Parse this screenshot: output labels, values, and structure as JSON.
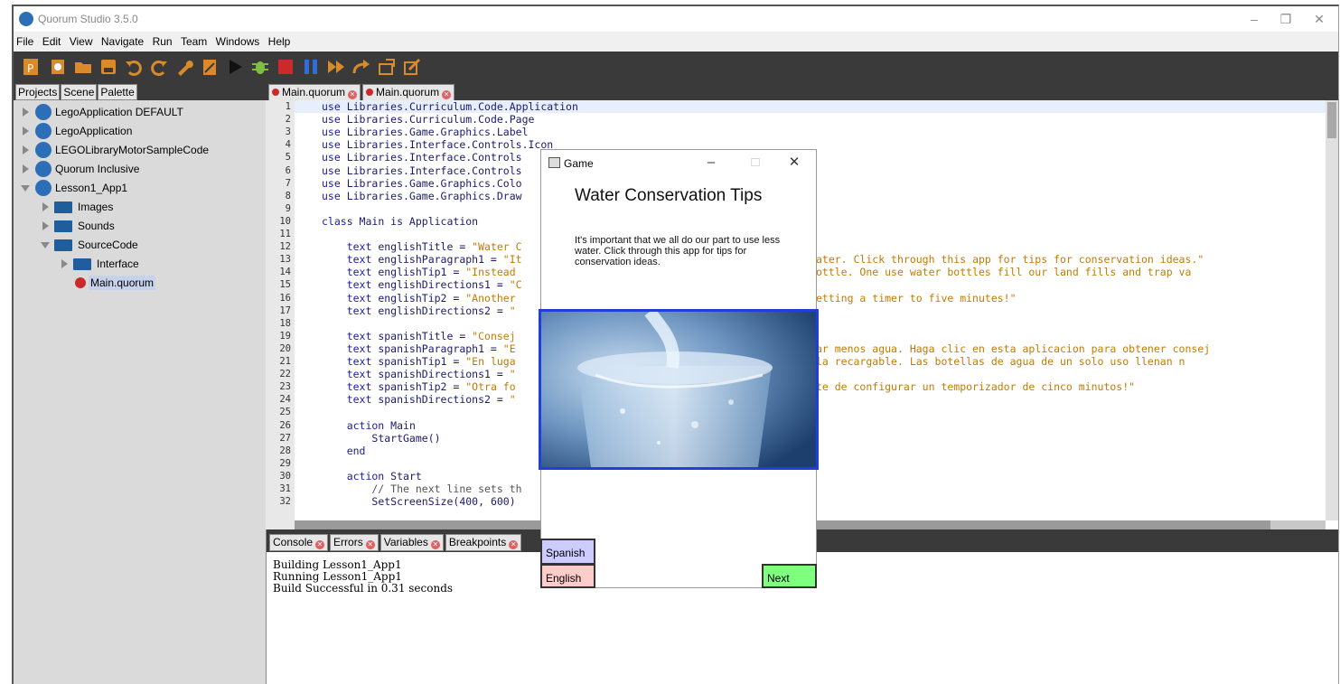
{
  "window": {
    "title": "Quorum Studio 3.5.0",
    "controls": [
      "–",
      "❐",
      "✕"
    ]
  },
  "menu": [
    "File",
    "Edit",
    "View",
    "Navigate",
    "Run",
    "Team",
    "Windows",
    "Help"
  ],
  "toolbar": {
    "icons": [
      "project-icon",
      "new-file-icon",
      "open-folder-icon",
      "save-icon",
      "undo-icon",
      "redo-icon",
      "build-icon",
      "clean-build-icon",
      "run-icon",
      "debug-icon",
      "stop-icon",
      "pause-icon",
      "step-over-icon",
      "step-into-icon",
      "step-out-icon",
      "run-to-cursor-icon"
    ]
  },
  "left_panel": {
    "tabs": [
      "Projects",
      "Scene",
      "Palette"
    ],
    "tree": [
      {
        "label": "LegoApplication DEFAULT"
      },
      {
        "label": "LegoApplication"
      },
      {
        "label": "LEGOLibraryMotorSampleCode"
      },
      {
        "label": "Quorum Inclusive"
      },
      {
        "label": "Lesson1_App1"
      },
      {
        "label": "Images"
      },
      {
        "label": "Sounds"
      },
      {
        "label": "SourceCode"
      },
      {
        "label": "Interface"
      },
      {
        "label": "Main.quorum"
      }
    ]
  },
  "editor": {
    "tabs": [
      "Main.quorum",
      "Main.quorum"
    ],
    "line_numbers": [
      "1",
      "2",
      "3",
      "4",
      "5",
      "6",
      "7",
      "8",
      "9",
      "10",
      "11",
      "12",
      "13",
      "14",
      "15",
      "16",
      "17",
      "18",
      "19",
      "20",
      "21",
      "22",
      "23",
      "24",
      "25",
      "26",
      "27",
      "28",
      "29",
      "30",
      "31",
      "32"
    ],
    "lines": [
      {
        "k": "use ",
        "t": "Libraries.Curriculum.Code.Application",
        "s": ""
      },
      {
        "k": "use ",
        "t": "Libraries.Curriculum.Code.Page",
        "s": ""
      },
      {
        "k": "use ",
        "t": "Libraries.Game.Graphics.Label",
        "s": ""
      },
      {
        "k": "use ",
        "t": "Libraries.Interface.Controls.Icon",
        "s": ""
      },
      {
        "k": "use ",
        "t": "Libraries.Interface.Controls",
        "s": ""
      },
      {
        "k": "use ",
        "t": "Libraries.Interface.Controls",
        "s": ""
      },
      {
        "k": "use ",
        "t": "Libraries.Game.Graphics.Colo",
        "s": ""
      },
      {
        "k": "use ",
        "t": "Libraries.Game.Graphics.Draw",
        "s": ""
      },
      {
        "k": "",
        "t": "",
        "s": ""
      },
      {
        "k": "class ",
        "t": "Main is Application",
        "s": ""
      },
      {
        "k": "",
        "t": "",
        "s": ""
      },
      {
        "k": "    text ",
        "t": "englishTitle = ",
        "s": "\"Water C                                            "
      },
      {
        "k": "    text ",
        "t": "englishParagraph1 = ",
        "s": "\"It                                     use less water. Click through this app for tips for conservation ideas.\""
      },
      {
        "k": "    text ",
        "t": "englishTip1 = ",
        "s": "\"Instead                                  a refillable bottle. One use water bottles fill our land fills and trap va"
      },
      {
        "k": "    text ",
        "t": "englishDirections1 = ",
        "s": "\"C"
      },
      {
        "k": "    text ",
        "t": "englishTip2 = ",
        "s": "\"Another                                  showers. Try setting a timer to five minutes!\""
      },
      {
        "k": "    text ",
        "t": "englishDirections2 = ",
        "s": "\""
      },
      {
        "k": "",
        "t": "",
        "s": ""
      },
      {
        "k": "    text ",
        "t": "spanishTitle = ",
        "s": "\"Consej"
      },
      {
        "k": "    text ",
        "t": "spanishParagraph1 = ",
        "s": "\"E                                     rte para usar menos agua. Haga clic en esta aplicacion para obtener consej"
      },
      {
        "k": "    text ",
        "t": "spanishTip1 = ",
        "s": "\"En luga                                 , use una botella recargable. Las botellas de agua de un solo uso llenan n"
      },
      {
        "k": "    text ",
        "t": "spanishDirections1 = ",
        "s": "\""
      },
      {
        "k": "    text ",
        "t": "spanishTip2 = ",
        "s": "\"Otra fo                                 mas cortas. Trate de configurar un temporizador de cinco minutos!\""
      },
      {
        "k": "    text ",
        "t": "spanishDirections2 = ",
        "s": "\""
      },
      {
        "k": "",
        "t": "",
        "s": ""
      },
      {
        "k": "    action ",
        "t": "Main",
        "s": ""
      },
      {
        "k": "        ",
        "t": "StartGame()",
        "s": ""
      },
      {
        "k": "    end",
        "t": "",
        "s": ""
      },
      {
        "k": "",
        "t": "",
        "s": ""
      },
      {
        "k": "    action ",
        "t": "Start",
        "s": ""
      },
      {
        "k": "",
        "t": "",
        "s": "",
        "c": "        // The next line sets th                               pixels tall."
      },
      {
        "k": "        ",
        "t": "SetScreenSize(400, 600)",
        "s": ""
      }
    ]
  },
  "console": {
    "tabs": [
      "Console",
      "Errors",
      "Variables",
      "Breakpoints"
    ],
    "lines": [
      "Building Lesson1_App1",
      "Running Lesson1_App1",
      "Build Successful in 0.31 seconds"
    ]
  },
  "game_window": {
    "title": "Game",
    "controls": [
      "–",
      "□",
      "✕"
    ],
    "heading": "Water Conservation Tips",
    "paragraph": "It's important that we all do our part to use less water. Click through this app for tips for conservation ideas.",
    "buttons": {
      "spanish": "Spanish",
      "english": "English",
      "next": "Next"
    },
    "colors": {
      "spanish": "#ccccff",
      "english": "#ffcccc",
      "next": "#7fff7f",
      "image_border": "#1f3fd6"
    }
  }
}
